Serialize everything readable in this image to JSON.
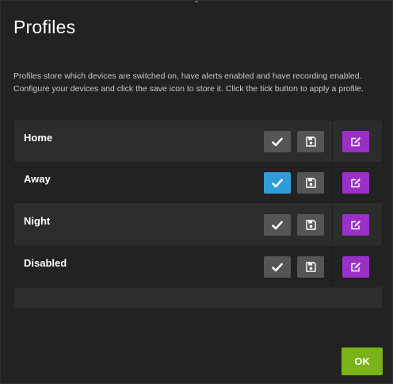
{
  "dialog": {
    "title": "Profiles",
    "description": "Profiles store which devices are switched on, have alerts enabled and have recording enabled. Configure your devices and click the save icon to store it. Click the tick button to apply a profile.",
    "ok_label": "OK"
  },
  "profiles": [
    {
      "name": "Home",
      "active": false
    },
    {
      "name": "Away",
      "active": true
    },
    {
      "name": "Night",
      "active": false
    },
    {
      "name": "Disabled",
      "active": false
    }
  ],
  "icons": {
    "apply": "check-icon",
    "save": "floppy-disk-icon",
    "edit": "pencil-square-icon"
  },
  "colors": {
    "dialog_background": "#222222",
    "apply_button": "#555555",
    "apply_button_active": "#2e9ed8",
    "save_button": "#555555",
    "edit_button": "#9b30c8",
    "ok_button": "#7ab317"
  }
}
